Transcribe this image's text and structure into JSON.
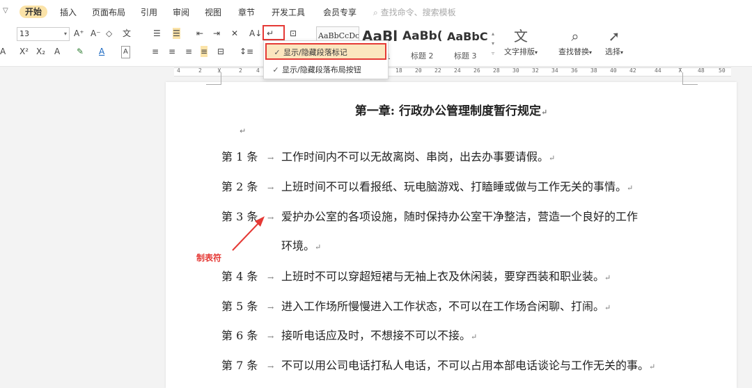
{
  "menu": {
    "collapse_glyph": "▽",
    "items": [
      "开始",
      "插入",
      "页面布局",
      "引用",
      "审阅",
      "视图",
      "章节",
      "开发工具",
      "会员专享"
    ],
    "active": "开始",
    "search_placeholder": "查找命令、搜索模板"
  },
  "ribbon": {
    "font_size": "13",
    "styles": [
      {
        "sample": "AaBbCcDc",
        "caption": ""
      },
      {
        "sample": "AaBl",
        "caption": "1"
      },
      {
        "sample": "AaBb(",
        "caption": "标题 2"
      },
      {
        "sample": "AaBbC",
        "caption": "标题 3"
      }
    ],
    "text_layout_label": "文字排版",
    "find_replace_label": "查找替换",
    "select_label": "选择"
  },
  "dropdown": {
    "items": [
      {
        "label": "显示/隐藏段落标记",
        "checked": true,
        "highlighted": true
      },
      {
        "label": "显示/隐藏段落布局按钮",
        "checked": true,
        "highlighted": false
      }
    ]
  },
  "ruler": {
    "ticks": [
      "4",
      "2",
      "2",
      "4",
      "18",
      "20",
      "22",
      "24",
      "26",
      "28",
      "30",
      "32",
      "34",
      "36",
      "38",
      "40",
      "42",
      "44",
      "48",
      "50"
    ]
  },
  "document": {
    "title": "第一章: 行政办公管理制度暂行规定",
    "paragraph_mark": "↵",
    "tab_mark": "→",
    "articles": [
      {
        "num": "第 1 条",
        "text": "工作时间内不可以无故离岗、串岗，出去办事要请假。",
        "cont": ""
      },
      {
        "num": "第 2 条",
        "text": "上班时间不可以看报纸、玩电脑游戏、打瞌睡或做与工作无关的事情。",
        "cont": ""
      },
      {
        "num": "第 3 条",
        "text": "爱护办公室的各项设施，随时保持办公室干净整洁，营造一个良好的工作",
        "cont": "环境。"
      },
      {
        "num": "第 4 条",
        "text": "上班时不可以穿超短裙与无袖上衣及休闲装，要穿西装和职业装。",
        "cont": ""
      },
      {
        "num": "第 5 条",
        "text": "进入工作场所慢慢进入工作状态，不可以在工作场合闲聊、打闹。",
        "cont": ""
      },
      {
        "num": "第 6 条",
        "text": "接听电话应及时，不想接不可以不接。",
        "cont": ""
      },
      {
        "num": "第 7 条",
        "text": "不可以用公司电话打私人电话，不可以占用本部电话谈论与工作无关的事。",
        "cont": ""
      }
    ]
  },
  "annotation": {
    "label": "制表符",
    "color": "#e53935"
  }
}
